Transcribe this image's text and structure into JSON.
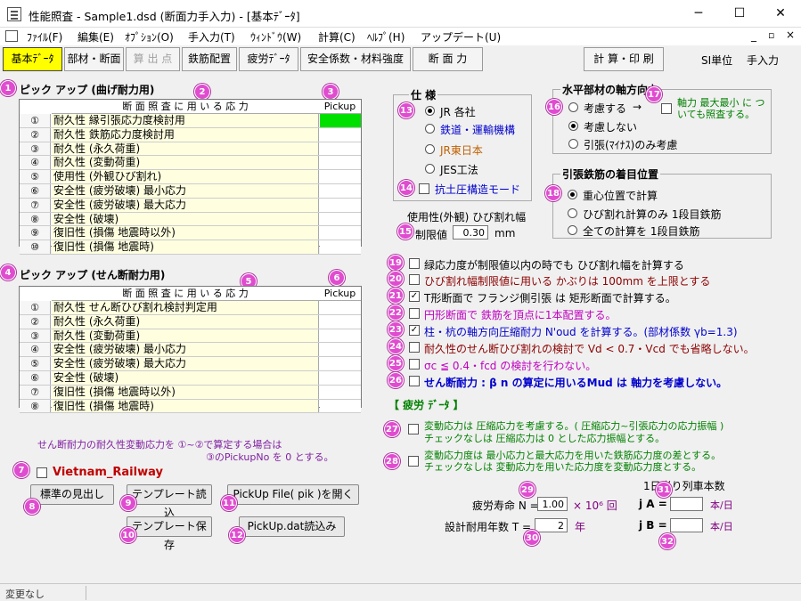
{
  "window": {
    "title": "性能照査 - Sample1.dsd (断面力手入力) - [基本ﾃﾞｰﾀ]",
    "minimize": "─",
    "maximize": "☐",
    "close": "✕"
  },
  "menu": [
    "ﾌｧｲﾙ(F)",
    "編集(E)",
    "ｵﾌﾟｼｮﾝ(O)",
    "手入力(T)",
    "ｳｨﾝﾄﾞｳ(W)",
    "計算(C)",
    "ﾍﾙﾌﾟ(H)",
    "アップデート(U)"
  ],
  "toolbar": {
    "tabs": [
      "基本ﾃﾞｰﾀ",
      "部材・断面",
      "算 出 点",
      "鉄筋配置",
      "疲労ﾃﾞｰﾀ",
      "安全係数・材料強度",
      "断 面 力"
    ],
    "calc_print": "計 算・印 刷",
    "si_unit": "SI単位",
    "manual_input": "手入力"
  },
  "pick1": {
    "title": "ピック アップ (曲げ耐力用)",
    "col_header": "断 面 照 査 に 用 い る 応 力",
    "pk_header": "Pickup No.",
    "rows": [
      [
        "①",
        "耐久性 縁引張応力度検討用"
      ],
      [
        "②",
        "耐久性 鉄筋応力度検討用"
      ],
      [
        "③",
        "耐久性 (永久荷重)"
      ],
      [
        "④",
        "耐久性 (変動荷重)"
      ],
      [
        "⑤",
        "使用性 (外観ひび割れ)"
      ],
      [
        "⑥",
        "安全性 (疲労破壊) 最小応力"
      ],
      [
        "⑦",
        "安全性 (疲労破壊) 最大応力"
      ],
      [
        "⑧",
        "安全性 (破壊)"
      ],
      [
        "⑨",
        "復旧性 (損傷 地震時以外)"
      ],
      [
        "⑩",
        "復旧性 (損傷 地震時)"
      ]
    ]
  },
  "pick2": {
    "title": "ピック アップ (せん断耐力用)",
    "col_header": "断 面 照 査 に 用 い る 応 力",
    "pk_header": "Pickup No.",
    "rows": [
      [
        "①",
        "耐久性 せん断ひび割れ検討判定用"
      ],
      [
        "②",
        "耐久性 (永久荷重)"
      ],
      [
        "③",
        "耐久性 (変動荷重)"
      ],
      [
        "④",
        "安全性 (疲労破壊) 最小応力"
      ],
      [
        "⑤",
        "安全性 (疲労破壊) 最大応力"
      ],
      [
        "⑥",
        "安全性 (破壊)"
      ],
      [
        "⑦",
        "復旧性 (損傷 地震時以外)"
      ],
      [
        "⑧",
        "復旧性 (損傷 地震時)"
      ]
    ]
  },
  "note": {
    "line1": "せん断耐力の耐久性変動応力を ①~②で算定する場合は",
    "line2": "③のPickupNo を 0 とする。"
  },
  "vietnam": "Vietnam_Railway",
  "buttons": {
    "standard_heading": "標準の見出し",
    "template_read": "テンプレート読込",
    "pickup_open": "PickUp File( pik )を開く",
    "template_save": "テンプレート保存",
    "pickup_dat": "PickUp.dat読込み"
  },
  "spec": {
    "title": "仕 様",
    "options": [
      "JR 各社",
      "鉄道・運輸機構",
      "JR東日本",
      "JES工法"
    ],
    "earth": "抗土圧構造モード"
  },
  "crack": {
    "title": "使用性(外観) ひび割れ幅",
    "label": "制限値",
    "value": "0.30",
    "unit": "mm"
  },
  "axial": {
    "title": "水平部材の軸方向力",
    "opts": [
      "考慮する",
      "考慮しない",
      "引張(ﾏｲﾅｽ)のみ考慮"
    ],
    "arrow": "→",
    "check_label": "軸力 最大最小 に ついても照査する。"
  },
  "rebar": {
    "title": "引張鉄筋の着目位置",
    "opts": [
      "重心位置で計算",
      "ひび割れ計算のみ 1段目鉄筋",
      "全ての計算を 1段目鉄筋"
    ]
  },
  "checks": [
    {
      "text": "緑応力度が制限値以内の時でも ひび割れ幅を計算する",
      "checked": false,
      "color": "#000000"
    },
    {
      "text": "ひび割れ幅制限値に用いる かぶりは 100mm を上限とする",
      "checked": false,
      "color": "#8b0000"
    },
    {
      "text": "T形断面で フランジ側引張 は 矩形断面で計算する。",
      "checked": true,
      "color": "#000000"
    },
    {
      "text": "円形断面で 鉄筋を頂点に1本配置する。",
      "checked": false,
      "color": "#c000c0"
    },
    {
      "text": "柱・杭の軸方向圧縮耐力 N'oud を計算する。(部材係数 γb=1.3)",
      "checked": true,
      "color": "#0000cc"
    },
    {
      "text": "耐久性のせん断ひび割れの検討で Vd < 0.7・Vcd でも省略しない。",
      "checked": false,
      "color": "#8b0000"
    },
    {
      "text": "σc ≦ 0.4・fcd の検討を行わない。",
      "checked": false,
      "color": "#c000c0"
    },
    {
      "text": "せん断耐力 : β n の算定に用いるMud は 軸力を考慮しない。",
      "checked": false,
      "color": "#0000cc"
    }
  ],
  "fatigue": {
    "title": "【 疲労 ﾃﾞｰﾀ 】",
    "c27a": "変動応力は 圧縮応力を考慮する。( 圧縮応力~引張応力の応力振幅 )",
    "c27b": "チェックなしは 圧縮応力は 0 とした応力振幅とする。",
    "c28a": "変動応力度は 最小応力と最大応力を用いた鉄筋応力度の差とする。",
    "c28b": "チェックなしは 変動応力を用いた応力度を変動応力度とする。",
    "trains_title": "1日当り列車本数",
    "life_label": "疲労寿命 N =",
    "life_value": "1.00",
    "life_unit": "× 10⁶ 回",
    "years_label": "設計耐用年数 T =",
    "years_value": "2",
    "years_unit": "年",
    "ja_label": "j A =",
    "ja_unit": "本/日",
    "jb_label": "j B =",
    "jb_unit": "本/日"
  },
  "status": "変更なし",
  "colors": {
    "accent": "#ffff00",
    "badge": "#e04cd0",
    "pick_fill": "#00e000"
  }
}
